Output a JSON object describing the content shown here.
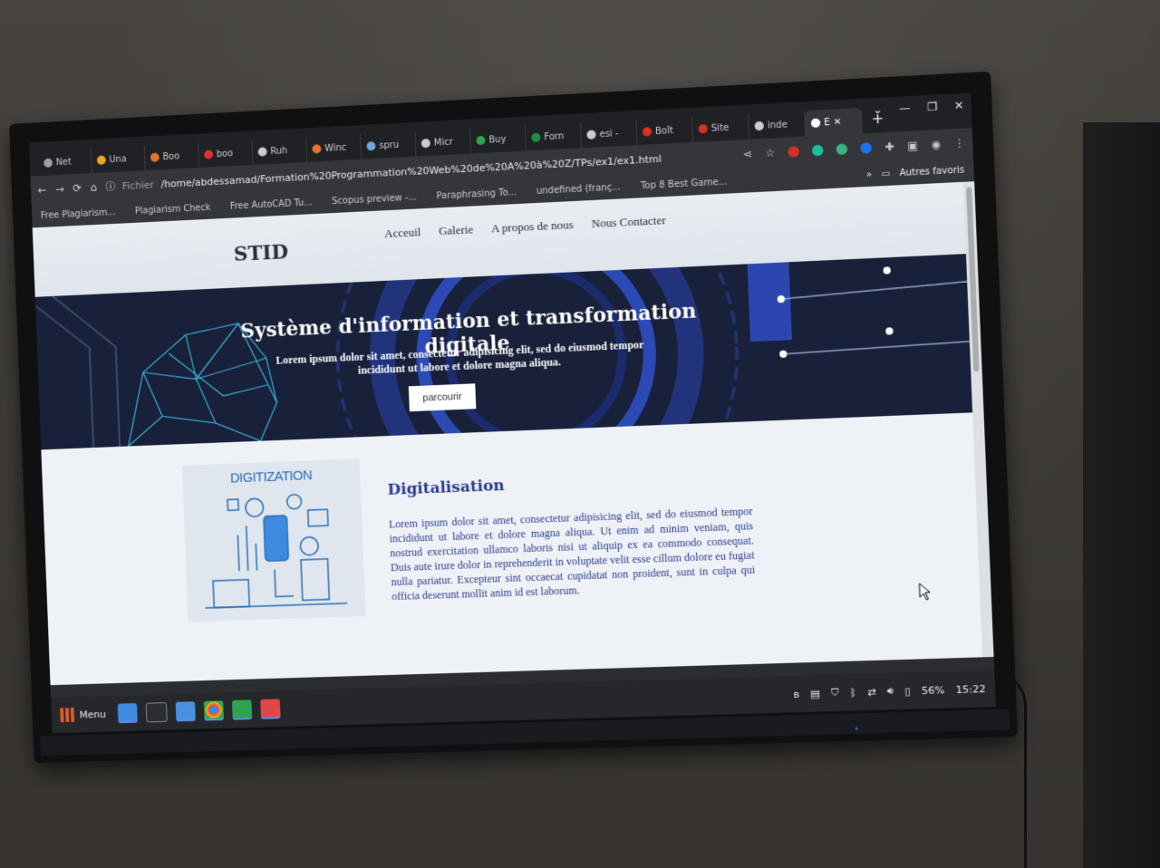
{
  "browser": {
    "tabs": [
      {
        "label": "Net",
        "icon": "globe-icon",
        "color": "#9aa0a6"
      },
      {
        "label": "Una",
        "icon": "windows-icon",
        "color": "#f5a623"
      },
      {
        "label": "Boo",
        "icon": "orange-icon",
        "color": "#e8732a"
      },
      {
        "label": "boo",
        "icon": "red-circle-icon",
        "color": "#d9342b"
      },
      {
        "label": "Ruh",
        "icon": "pen-icon",
        "color": "#c8cbd0"
      },
      {
        "label": "Winc",
        "icon": "orange-icon",
        "color": "#e8732a"
      },
      {
        "label": "spru",
        "icon": "doc-icon",
        "color": "#6fa8dc"
      },
      {
        "label": "Micr",
        "icon": "c-icon",
        "color": "#c8cbd0"
      },
      {
        "label": "Buy",
        "icon": "s-icon",
        "color": "#2ea44f"
      },
      {
        "label": "Forn",
        "icon": "sheet-icon",
        "color": "#1e8e3e"
      },
      {
        "label": "esi -",
        "icon": "g-icon",
        "color": "#c8cbd0"
      },
      {
        "label": "Boît",
        "icon": "gmail-icon",
        "color": "#d93025"
      },
      {
        "label": "Site",
        "icon": "red-icon",
        "color": "#d93025"
      },
      {
        "label": "inde",
        "icon": "globe-icon",
        "color": "#c8cbd0"
      },
      {
        "label": "E",
        "icon": "globe-icon",
        "color": "#ffffff",
        "active": true
      }
    ],
    "new_tab": "+",
    "omnibox": {
      "scheme": "Fichier",
      "url": "/home/abdessamad/Formation%20Programmation%20Web%20de%20A%20à%20Z/TPs/ex1/ex1.html"
    },
    "bookmarks": [
      {
        "label": "Free Plagiarism..."
      },
      {
        "label": "Plagiarism Check"
      },
      {
        "label": "Free AutoCAD Tu..."
      },
      {
        "label": "Scopus preview -..."
      },
      {
        "label": "Paraphrasing To..."
      },
      {
        "label": "undefined (franç..."
      },
      {
        "label": "Top 8 Best Game..."
      }
    ],
    "bookmarks_more": "»",
    "other_bookmarks": "Autres favoris"
  },
  "site": {
    "logo": "STID",
    "nav": [
      "Acceuil",
      "Galerie",
      "A propos de nous",
      "Nous Contacter"
    ],
    "hero": {
      "title": "Système d'information et transformation digitale",
      "text": "Lorem ipsum dolor sit amet, consectetur adipisicing elit, sed do eiusmod tempor incididunt ut labore et dolore magna aliqua.",
      "button": "parcourir"
    },
    "section": {
      "image_caption": "DIGITIZATION",
      "title": "Digitalisation",
      "text": "Lorem ipsum dolor sit amet, consectetur adipisicing elit, sed do eiusmod tempor incididunt ut labore et dolore magna aliqua. Ut enim ad minim veniam, quis nostrud exercitation ullamco laboris nisi ut aliquip ex ea commodo consequat. Duis aute irure dolor in reprehenderit in voluptate velit esse cillum dolore eu fugiat nulla pariatur. Excepteur sint occaecat cupidatat non proident, sunt in culpa qui officia deserunt mollit anim id est laborum."
    }
  },
  "taskbar": {
    "menu_label": "Menu",
    "battery": "56%",
    "time": "15:22"
  }
}
